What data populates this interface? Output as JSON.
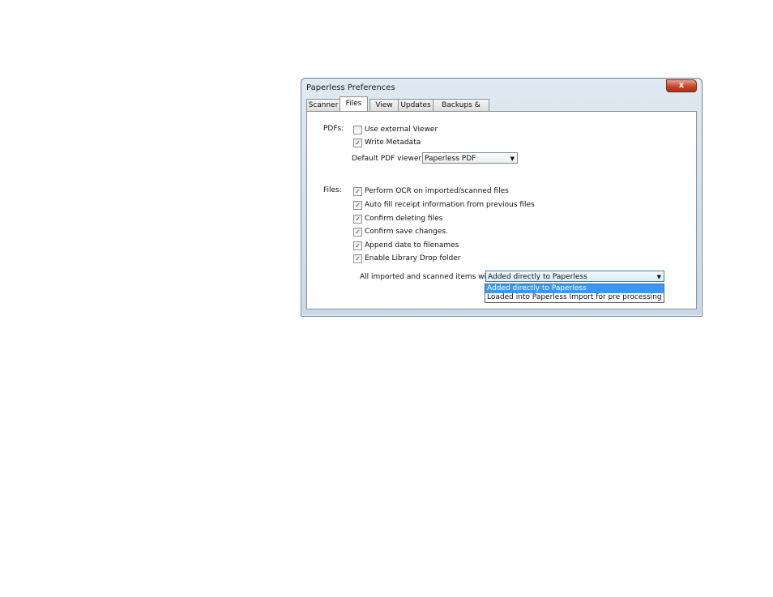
{
  "window": {
    "title": "Paperless Preferences",
    "close_glyph": "x"
  },
  "tabs": [
    {
      "label": "Scanner",
      "active": false
    },
    {
      "label": "Files",
      "active": true
    },
    {
      "label": "View",
      "active": false
    },
    {
      "label": "Updates",
      "active": false
    },
    {
      "label": "Backups & Misc",
      "active": false
    }
  ],
  "pdfs": {
    "section_label": "PDFs:",
    "use_external_viewer": {
      "label": "Use external Viewer",
      "checked": false
    },
    "write_metadata": {
      "label": "Write Metadata",
      "checked": true
    },
    "default_viewer_label": "Default PDF viewer:",
    "default_viewer_value": "Paperless PDF"
  },
  "files": {
    "section_label": "Files:",
    "options": [
      {
        "label": "Perform OCR on imported/scanned files",
        "checked": true
      },
      {
        "label": "Auto fill receipt information from previous files",
        "checked": true
      },
      {
        "label": "Confirm deleting files",
        "checked": true
      },
      {
        "label": "Confirm save changes.",
        "checked": true
      },
      {
        "label": "Append date to filenames",
        "checked": true
      },
      {
        "label": "Enable Library Drop folder",
        "checked": true
      }
    ],
    "import_label": "All imported and scanned items will be:",
    "import_value": "Added directly to Paperless",
    "import_options": [
      {
        "label": "Added directly to Paperless",
        "selected": true
      },
      {
        "label": "Loaded into Paperless Import for pre processing",
        "selected": false
      }
    ]
  },
  "check_glyph": "✓",
  "dropdown_arrow": "▼"
}
